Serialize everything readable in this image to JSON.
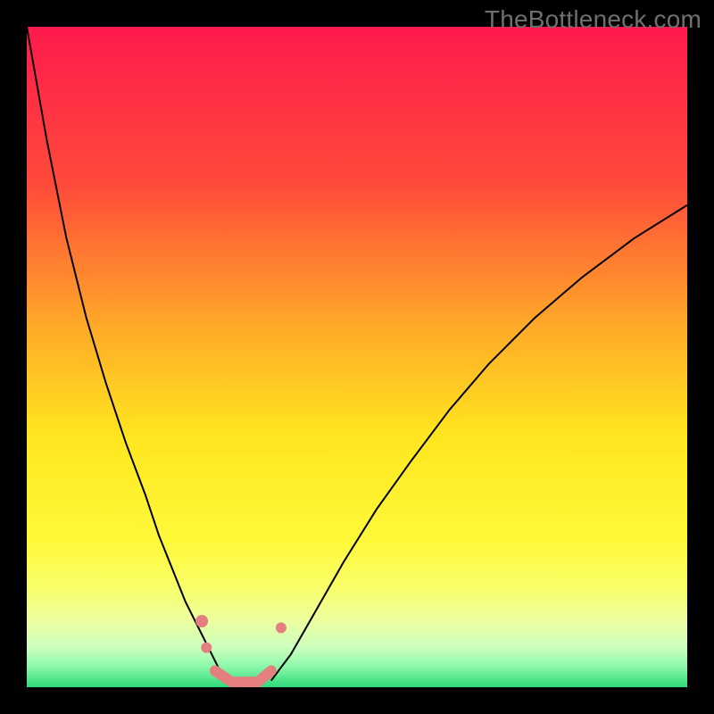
{
  "watermark": "TheBottleneck.com",
  "frameColor": "#000000",
  "chart_data": {
    "type": "line",
    "title": "",
    "xlabel": "",
    "ylabel": "",
    "xlim": [
      0,
      100
    ],
    "ylim": [
      0,
      100
    ],
    "grid": false,
    "background": {
      "type": "vertical-gradient",
      "stops": [
        {
          "pos": 0.0,
          "color": "#ff1a4d"
        },
        {
          "pos": 0.24,
          "color": "#ff4b3a"
        },
        {
          "pos": 0.45,
          "color": "#ffa828"
        },
        {
          "pos": 0.62,
          "color": "#ffe61f"
        },
        {
          "pos": 0.78,
          "color": "#fff93a"
        },
        {
          "pos": 0.85,
          "color": "#f8ff6a"
        },
        {
          "pos": 0.9,
          "color": "#ecffa0"
        },
        {
          "pos": 0.94,
          "color": "#ccffc0"
        },
        {
          "pos": 0.97,
          "color": "#88f8a8"
        },
        {
          "pos": 1.0,
          "color": "#2fd978"
        }
      ]
    },
    "series": [
      {
        "name": "left-curve",
        "stroke": "#000000",
        "strokeWidth": 2,
        "x": [
          0,
          3,
          6,
          9,
          12,
          15,
          18,
          20,
          22,
          24,
          25.5,
          27,
          28.5,
          30
        ],
        "y": [
          100,
          83,
          68,
          56,
          46,
          37,
          29,
          23,
          18,
          13,
          10,
          7,
          4,
          1
        ]
      },
      {
        "name": "right-curve",
        "stroke": "#000000",
        "strokeWidth": 2,
        "x": [
          37,
          40,
          44,
          48,
          53,
          58,
          64,
          70,
          77,
          84,
          92,
          100
        ],
        "y": [
          1,
          5,
          12,
          19,
          27,
          34,
          42,
          49,
          56,
          62,
          68,
          73
        ]
      },
      {
        "name": "bottom-band",
        "type": "band",
        "stroke": "#e37f7e",
        "strokeWidth": 12,
        "linecap": "round",
        "x": [
          28.5,
          31,
          33,
          35,
          37
        ],
        "y": [
          2.5,
          0.8,
          0.8,
          0.8,
          2.5
        ]
      }
    ],
    "markers": [
      {
        "series": "bottom-band",
        "x": 26.5,
        "y": 10,
        "r": 7,
        "color": "#e37f7e"
      },
      {
        "series": "bottom-band",
        "x": 27.2,
        "y": 6,
        "r": 6,
        "color": "#e37f7e"
      },
      {
        "series": "bottom-band",
        "x": 38.5,
        "y": 9,
        "r": 6,
        "color": "#e37f7e"
      }
    ]
  }
}
